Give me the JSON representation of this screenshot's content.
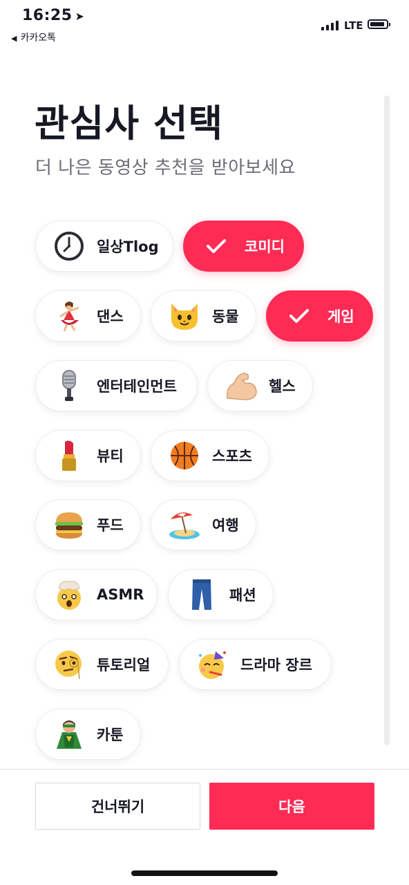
{
  "status_bar": {
    "time": "16:25",
    "location_arrow": "➤",
    "back_app": "카카오톡",
    "network": "LTE"
  },
  "header": {
    "title": "관심사 선택",
    "subtitle": "더 나은 동영상 추천을 받아보세요"
  },
  "interests": [
    {
      "label": "일상Tlog",
      "icon": "clock-icon",
      "selected": false
    },
    {
      "label": "코미디",
      "icon": "check-icon",
      "selected": true
    },
    {
      "label": "댄스",
      "icon": "dancer-icon",
      "selected": false
    },
    {
      "label": "동물",
      "icon": "cat-face-icon",
      "selected": false
    },
    {
      "label": "게임",
      "icon": "check-icon",
      "selected": true
    },
    {
      "label": "엔터테인먼트",
      "icon": "microphone-icon",
      "selected": false
    },
    {
      "label": "헬스",
      "icon": "flexed-biceps-icon",
      "selected": false
    },
    {
      "label": "뷰티",
      "icon": "lipstick-icon",
      "selected": false
    },
    {
      "label": "스포츠",
      "icon": "basketball-icon",
      "selected": false
    },
    {
      "label": "푸드",
      "icon": "hamburger-icon",
      "selected": false
    },
    {
      "label": "여행",
      "icon": "beach-umbrella-icon",
      "selected": false
    },
    {
      "label": "ASMR",
      "icon": "exploding-head-icon",
      "selected": false
    },
    {
      "label": "패션",
      "icon": "jeans-icon",
      "selected": false
    },
    {
      "label": "튜토리얼",
      "icon": "monocle-face-icon",
      "selected": false
    },
    {
      "label": "드라마 장르",
      "icon": "partying-face-icon",
      "selected": false
    },
    {
      "label": "카툰",
      "icon": "superhero-icon",
      "selected": false
    }
  ],
  "footer": {
    "skip_label": "건너뛰기",
    "next_label": "다음"
  },
  "colors": {
    "accent": "#FE2C55",
    "text": "#161823",
    "subtext": "#6B6D75"
  }
}
